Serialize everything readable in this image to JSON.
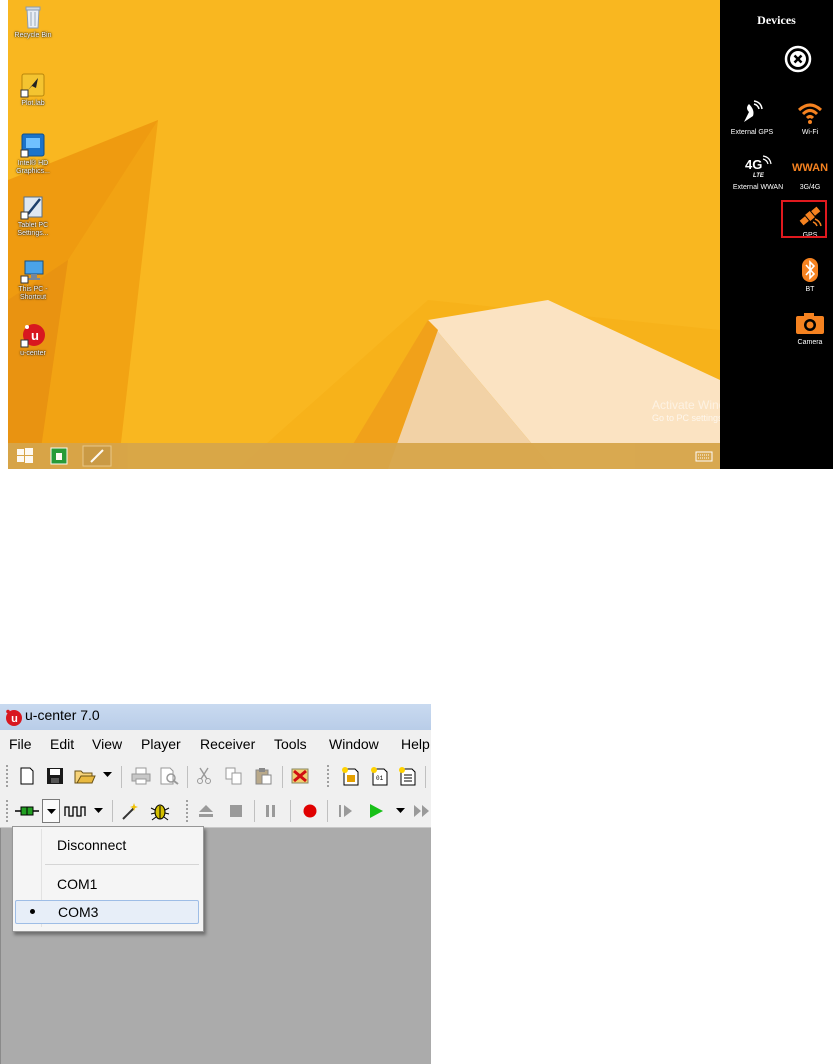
{
  "desktop": {
    "icons": [
      {
        "label": "Recycle Bin",
        "icon": "recycle-bin-icon"
      },
      {
        "label": "Plot.lab",
        "icon": "plotlab-icon"
      },
      {
        "label": "Intel® HD Graphics...",
        "icon": "intel-graphics-icon"
      },
      {
        "label": "Tablet PC Settings...",
        "icon": "tablet-pc-settings-icon"
      },
      {
        "label": "This PC - Shortcut",
        "icon": "this-pc-icon"
      },
      {
        "label": "u-center",
        "icon": "u-center-icon"
      }
    ],
    "watermark_title": "Activate Windows",
    "watermark_text": "Go to PC settings to activate Windows.",
    "wallpaper_colors": {
      "main": "#f7b21a",
      "dark": "#ee9a11",
      "light": "#fbe3c2"
    }
  },
  "devices_panel": {
    "title": "Devices",
    "close_icon": "close-icon",
    "items": [
      {
        "label": "External GPS",
        "icon": "external-gps-icon"
      },
      {
        "label": "Wi-Fi",
        "icon": "wifi-icon"
      },
      {
        "label": "External WWAN",
        "icon": "4g-lte-icon"
      },
      {
        "label": "3G/4G",
        "icon": "wwan-icon",
        "badge": "WWAN"
      },
      {
        "label": "GPS",
        "icon": "gps-satellite-icon",
        "highlighted": true
      },
      {
        "label": "BT",
        "icon": "bluetooth-icon"
      },
      {
        "label": "Camera",
        "icon": "camera-icon"
      }
    ],
    "accent": "#f58220",
    "highlight_color": "#e0191e"
  },
  "ucenter": {
    "title": "u-center 7.0",
    "menus": [
      "File",
      "Edit",
      "View",
      "Player",
      "Receiver",
      "Tools",
      "Window",
      "Help"
    ],
    "dropdown": {
      "items": [
        {
          "label": "Disconnect",
          "selected": false
        },
        {
          "label": "COM1",
          "selected": false
        },
        {
          "label": "COM3",
          "selected": true
        }
      ]
    }
  }
}
